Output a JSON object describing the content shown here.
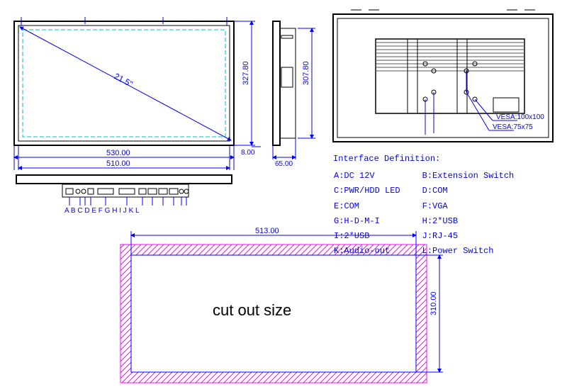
{
  "front": {
    "diagonal_label": "21.5\"",
    "height": "327.80",
    "width": "530.00",
    "inner_width": "510.00",
    "depth_step": "8.00"
  },
  "side": {
    "height": "307.80",
    "depth": "65.00"
  },
  "back": {
    "vesa100": "VESA:100x100",
    "vesa75": "VESA:75x75"
  },
  "interface": {
    "title": "Interface Definition:",
    "rows": [
      [
        "A:DC 12V",
        "B:Extension Switch"
      ],
      [
        "C:PWR/HDD LED",
        "D:COM"
      ],
      [
        "E:COM",
        "F:VGA"
      ],
      [
        "G:H-D-M-I",
        "H:2*USB"
      ],
      [
        "I:2*USB",
        "J:RJ-45"
      ],
      [
        "K:Audio-out",
        "L:Power Switch"
      ]
    ],
    "labels": "A  B C D      E       F  G H   I  J K  L"
  },
  "cutout": {
    "width": "513.00",
    "height": "310.00",
    "label": "cut out size"
  }
}
